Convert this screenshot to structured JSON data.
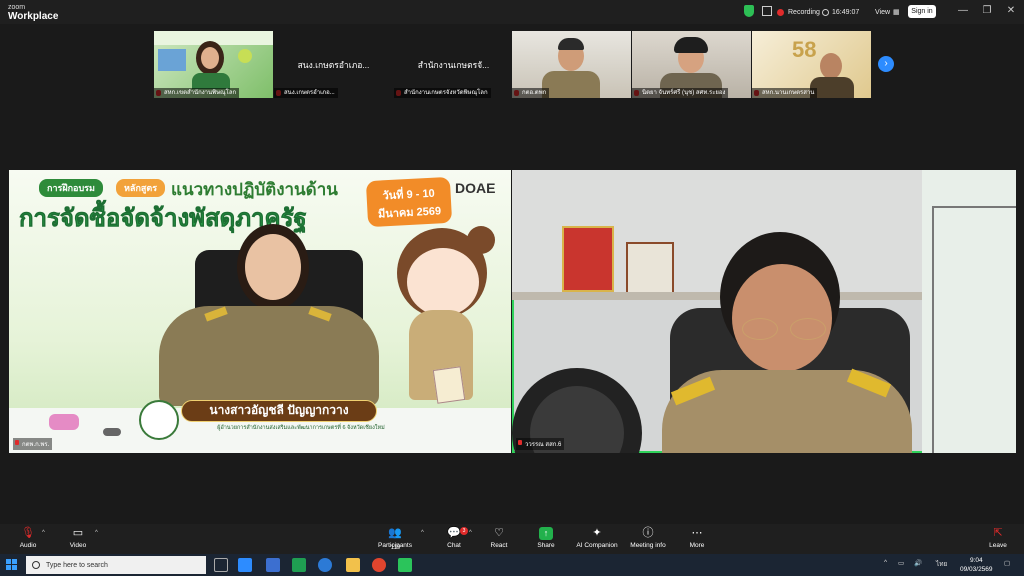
{
  "app": {
    "brand_top": "zoom",
    "brand_bottom": "Workplace"
  },
  "header": {
    "recording_label": "Recording",
    "timer": "16:49:07",
    "view_label": "View",
    "signin_label": "Sign in"
  },
  "gallery": [
    {
      "name": "สหก.เขตสำนักงานพิษณุโลก"
    },
    {
      "name": "สนง.เกษตรอำเภอ...",
      "caption": "สนง.เกษตรอำเภอ..."
    },
    {
      "name": "สำนักงานเกษตรจังหวัดพิษณุโลก",
      "caption": "สำนักงานเกษตรจั..."
    },
    {
      "name": "กตอ.ตพก"
    },
    {
      "name": "นิตยา จันทร์ศรี (นุช) สศท.ระยอง"
    },
    {
      "name": "สหก.นานเกษตรสาน"
    }
  ],
  "slide": {
    "badge1": "การฝึกอบรม",
    "badge2": "หลักสูตร",
    "heading1": "แนวทางปฏิบัติงานด้าน",
    "heading2": "การจัดซื้อจัดจ้างพัสดุภาครัฐ",
    "date1": "วันที่ 9 - 10",
    "date2": "มีนาคม 2569",
    "logo": "DOAE",
    "speaker_name": "นางสาวอัญชลี ปัญญากวาง",
    "speaker_title": "ผู้อำนวยการสำนักงานส่งเสริมและพัฒนาการเกษตรที่ 6 จังหวัดเชียงใหม่",
    "participant": "กตพ.ก.พร."
  },
  "active_speaker": {
    "name": "ววรรณ สสก.6"
  },
  "toolbar": {
    "audio": "Audio",
    "video": "Video",
    "participants": "Participants",
    "participants_count": "119",
    "chat": "Chat",
    "chat_badge": "3",
    "react": "React",
    "share": "Share",
    "ai": "AI Companion",
    "meeting_info": "Meeting info",
    "more": "More",
    "leave": "Leave"
  },
  "taskbar": {
    "search_placeholder": "Type here to search",
    "time": "9:04",
    "date": "09/03/2569",
    "lang": "ไทย"
  }
}
